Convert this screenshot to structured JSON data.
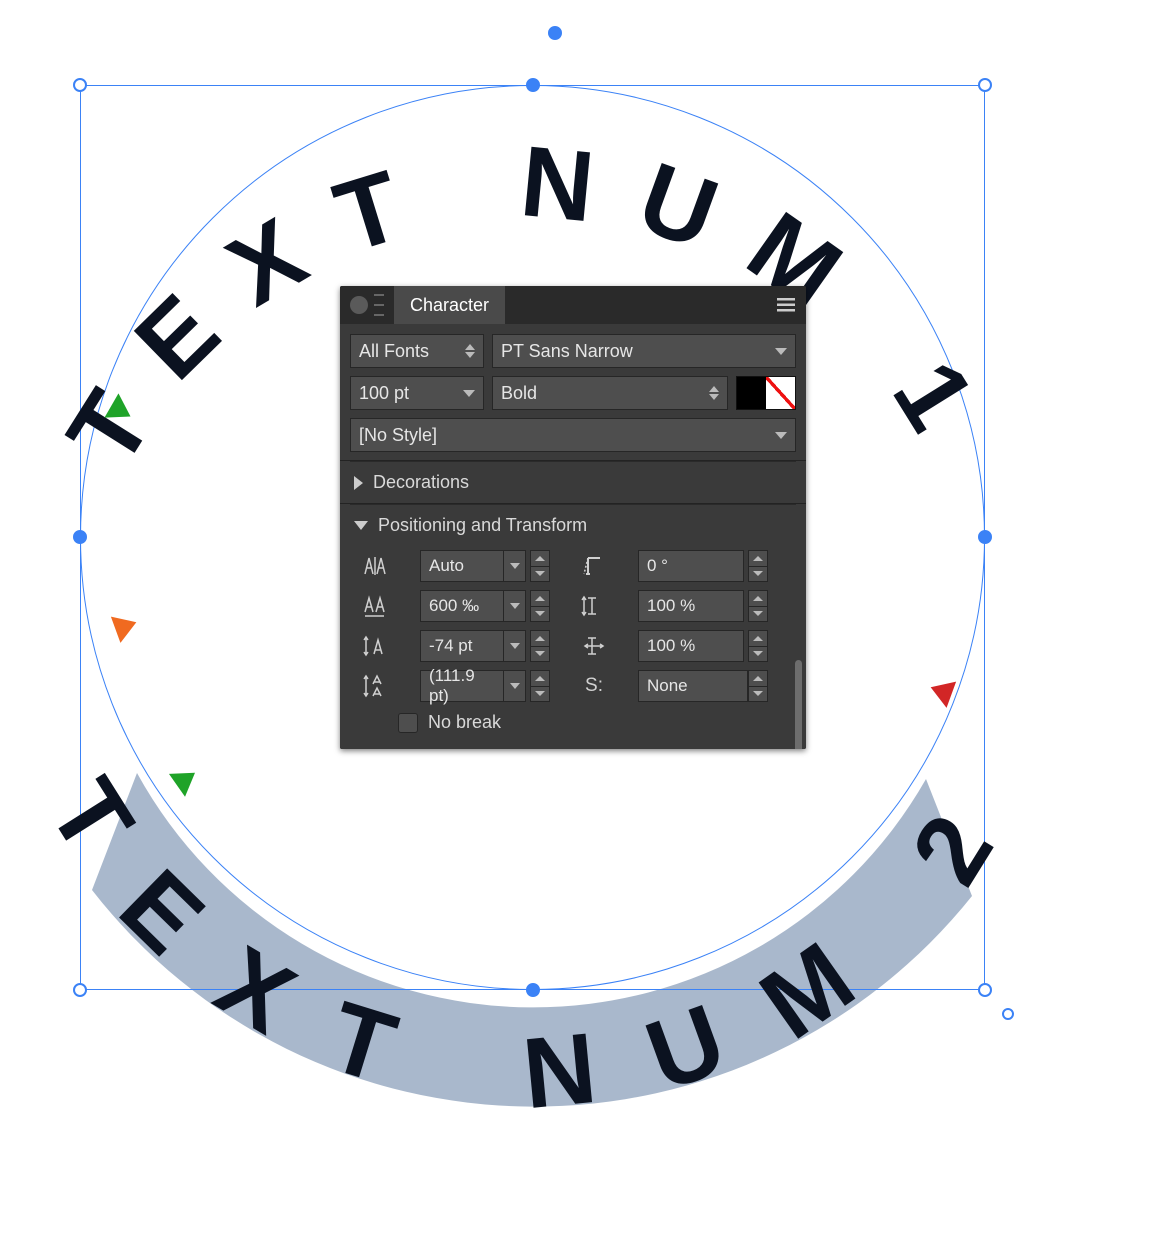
{
  "canvas": {
    "text_top": "TEXT NUM 1",
    "text_bottom": "TEXT NUM 2"
  },
  "panel": {
    "title": "Character",
    "font_category": "All Fonts",
    "font_family": "PT Sans Narrow",
    "font_size": "100 pt",
    "font_weight": "Bold",
    "style": "[No Style]",
    "sections": {
      "decorations": "Decorations",
      "positioning": "Positioning and Transform"
    },
    "positioning": {
      "kerning": "Auto",
      "tracking": "600 ‰",
      "baseline_shift": "-74 pt",
      "leading": "(111.9 pt)",
      "shear": "0 °",
      "vscale": "100 %",
      "hscale": "100 %",
      "caps_style": "None"
    },
    "caps_label": "S:",
    "no_break_label": "No break"
  }
}
